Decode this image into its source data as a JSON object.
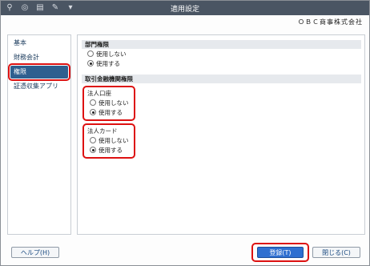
{
  "window": {
    "title": "適用設定"
  },
  "toolbar": {
    "icons": [
      "search-plus-icon",
      "zoom-icon",
      "print-icon",
      "tools-icon",
      "dropdown-icon"
    ]
  },
  "company": {
    "name": "ＯＢＣ商事株式会社"
  },
  "sidebar": {
    "items": [
      {
        "label": "基本"
      },
      {
        "label": "財務会計"
      },
      {
        "label": "権限"
      },
      {
        "label": "証憑収集アプリ"
      }
    ],
    "active_index": 2
  },
  "sections": {
    "dept": {
      "header": "部門権限",
      "options": [
        "使用しない",
        "使用する"
      ],
      "selected": 1
    },
    "bank": {
      "header": "取引金融機関権限",
      "corp_account": {
        "label": "法人口座",
        "options": [
          "使用しない",
          "使用する"
        ],
        "selected": 1
      },
      "corp_card": {
        "label": "法人カード",
        "options": [
          "使用しない",
          "使用する"
        ],
        "selected": 1
      }
    }
  },
  "footer": {
    "help_label": "ヘルプ(H)",
    "register_label": "登録(T)",
    "close_label": "閉じる(C)"
  }
}
